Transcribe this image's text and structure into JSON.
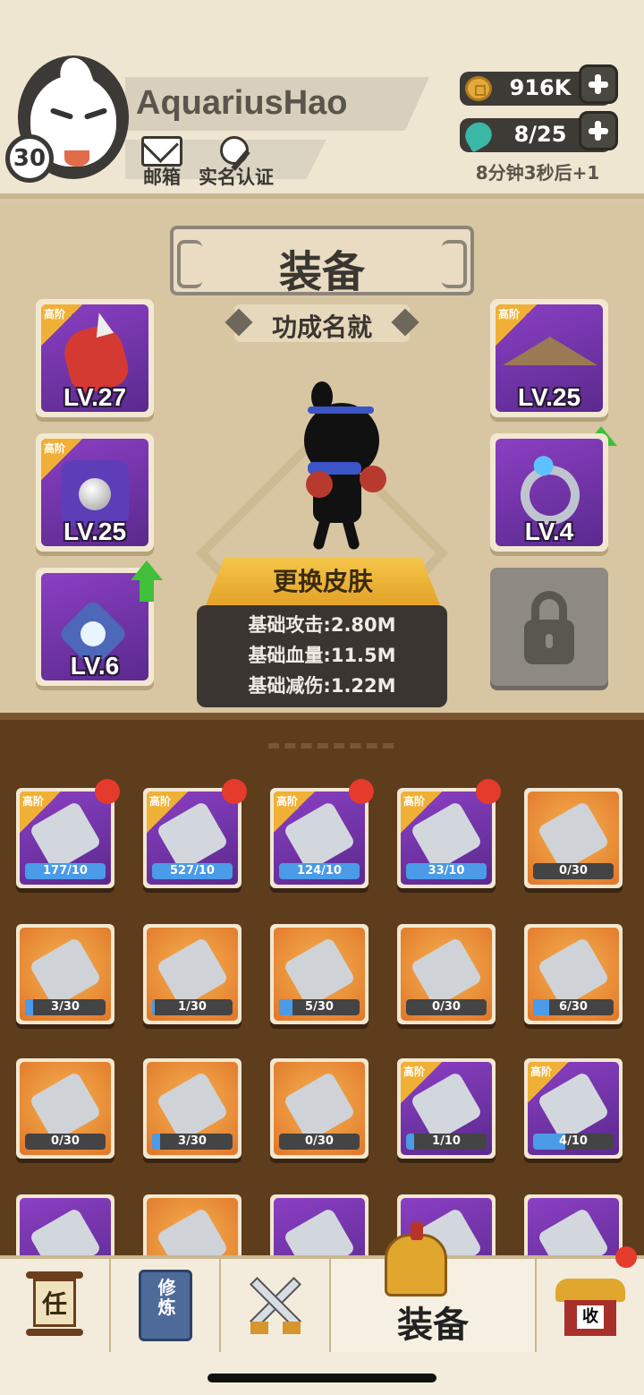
{
  "player": {
    "name": "AquariusHao",
    "level": "30"
  },
  "header_buttons": {
    "mail": "邮箱",
    "verify": "实名认证"
  },
  "resources": {
    "gold": "916K",
    "stamina": "8/25",
    "timer": "8分钟3秒后+1"
  },
  "equipment": {
    "title": "装备",
    "rank": "功成名就",
    "tier_label": "高阶",
    "slots": [
      {
        "name": "glove",
        "level": "LV.27",
        "tier": true
      },
      {
        "name": "armor",
        "level": "LV.25",
        "tier": true
      },
      {
        "name": "necklace",
        "level": "LV.6",
        "tier": false,
        "upgrade": true
      },
      {
        "name": "hat",
        "level": "LV.25",
        "tier": true,
        "upgrade": true
      },
      {
        "name": "ring",
        "level": "LV.4",
        "tier": false
      }
    ],
    "locked_slot": "lock-icon",
    "skin_button": "更换皮肤",
    "stats": [
      "基础攻击:2.80M",
      "基础血量:11.5M",
      "基础减伤:1.22M"
    ]
  },
  "inventory": {
    "rows": [
      [
        {
          "rarity": "purple",
          "tier": true,
          "count": "177/10",
          "progress": 1.0,
          "new": true
        },
        {
          "rarity": "purple",
          "tier": true,
          "count": "527/10",
          "progress": 1.0,
          "new": true
        },
        {
          "rarity": "purple",
          "tier": true,
          "count": "124/10",
          "progress": 1.0,
          "new": true
        },
        {
          "rarity": "purple",
          "tier": true,
          "count": "33/10",
          "progress": 1.0,
          "new": true
        },
        {
          "rarity": "orange",
          "tier": false,
          "count": "0/30",
          "progress": 0.0,
          "new": false
        }
      ],
      [
        {
          "rarity": "orange",
          "tier": false,
          "count": "3/30",
          "progress": 0.1,
          "new": false
        },
        {
          "rarity": "orange",
          "tier": false,
          "count": "1/30",
          "progress": 0.033,
          "new": false
        },
        {
          "rarity": "orange",
          "tier": false,
          "count": "5/30",
          "progress": 0.167,
          "new": false
        },
        {
          "rarity": "orange",
          "tier": false,
          "count": "0/30",
          "progress": 0.0,
          "new": false
        },
        {
          "rarity": "orange",
          "tier": false,
          "count": "6/30",
          "progress": 0.2,
          "new": false
        }
      ],
      [
        {
          "rarity": "orange",
          "tier": false,
          "count": "0/30",
          "progress": 0.0,
          "new": false
        },
        {
          "rarity": "orange",
          "tier": false,
          "count": "3/30",
          "progress": 0.1,
          "new": false
        },
        {
          "rarity": "orange",
          "tier": false,
          "count": "0/30",
          "progress": 0.0,
          "new": false
        },
        {
          "rarity": "purple",
          "tier": true,
          "count": "1/10",
          "progress": 0.1,
          "new": false
        },
        {
          "rarity": "purple",
          "tier": true,
          "count": "4/10",
          "progress": 0.4,
          "new": false
        }
      ],
      [
        {
          "rarity": "purple",
          "tier": false,
          "count": "",
          "progress": 0.0,
          "new": false
        },
        {
          "rarity": "orange",
          "tier": false,
          "count": "",
          "progress": 0.0,
          "new": false
        },
        {
          "rarity": "purple",
          "tier": false,
          "count": "",
          "progress": 0.0,
          "new": false
        },
        {
          "rarity": "purple",
          "tier": false,
          "count": "",
          "progress": 0.0,
          "new": false
        },
        {
          "rarity": "purple",
          "tier": false,
          "count": "",
          "progress": 0.0,
          "new": false
        }
      ]
    ]
  },
  "nav": {
    "task_glyph": "任",
    "cultivate_glyph": "修炼",
    "equip_label": "装备",
    "shop_glyph": "收"
  },
  "colors": {
    "accent_gold": "#f0b035",
    "purple_rarity": "#8b3fc3",
    "orange_rarity": "#e0762a",
    "upgrade_green": "#3fbf3a",
    "notify_red": "#e53b2c"
  }
}
